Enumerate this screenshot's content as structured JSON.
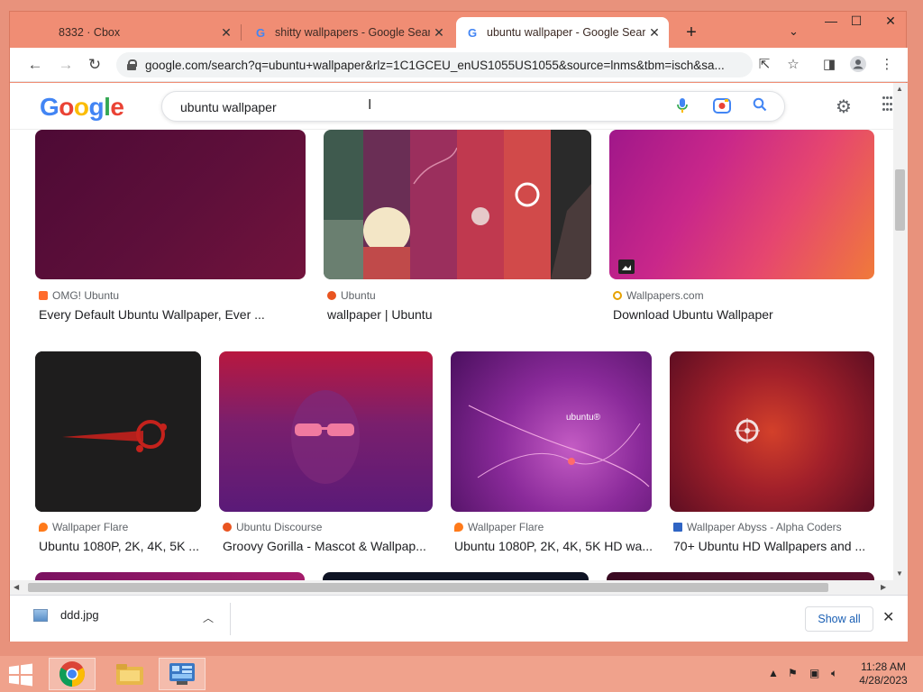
{
  "browser": {
    "tabs": [
      {
        "title": "8332 · Cbox",
        "active": false
      },
      {
        "title": "shitty wallpapers - Google Search",
        "active": false
      },
      {
        "title": "ubuntu wallpaper - Google Search",
        "active": true
      }
    ],
    "url": "google.com/search?q=ubuntu+wallpaper&rlz=1C1GCEU_enUS1055US1055&source=lnms&tbm=isch&sa..."
  },
  "google": {
    "logo": [
      "G",
      "o",
      "o",
      "g",
      "l",
      "e"
    ],
    "query": "ubuntu wallpaper"
  },
  "results": {
    "row1": [
      {
        "source": "OMG! Ubuntu",
        "title": "Every Default Ubuntu Wallpaper, Ever ..."
      },
      {
        "source": "Ubuntu",
        "title": "wallpaper | Ubuntu"
      },
      {
        "source": "Wallpapers.com",
        "title": "Download Ubuntu Wallpaper"
      }
    ],
    "row2": [
      {
        "source": "Wallpaper Flare",
        "title": "Ubuntu 1080P, 2K, 4K, 5K ..."
      },
      {
        "source": "Ubuntu Discourse",
        "title": "Groovy Gorilla - Mascot & Wallpap..."
      },
      {
        "source": "Wallpaper Flare",
        "title": "Ubuntu 1080P, 2K, 4K, 5K HD wa..."
      },
      {
        "source": "Wallpaper Abyss - Alpha Coders",
        "title": "70+ Ubuntu HD Wallpapers and ..."
      }
    ],
    "thumb_text": "ubuntu®"
  },
  "downloads": {
    "file": "ddd.jpg",
    "show_all": "Show all"
  },
  "taskbar": {
    "time": "11:28 AM",
    "date": "4/28/2023"
  },
  "colors": {
    "window_frame": "#f08d74",
    "google_blue": "#4285f4",
    "google_red": "#ea4335",
    "google_yellow": "#fbbc05",
    "google_green": "#34a853"
  }
}
